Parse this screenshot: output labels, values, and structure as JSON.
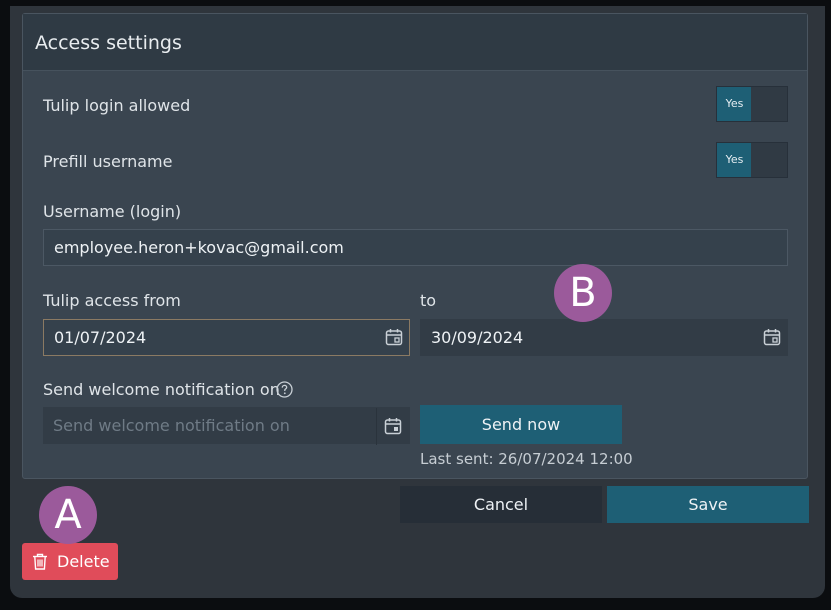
{
  "card": {
    "title": "Access settings"
  },
  "fields": {
    "login_allowed": {
      "label": "Tulip login allowed",
      "toggle_on_label": "Yes"
    },
    "prefill_username": {
      "label": "Prefill username",
      "toggle_on_label": "Yes"
    },
    "username": {
      "label": "Username (login)",
      "value": "employee.heron+kovac@gmail.com"
    },
    "access_from": {
      "label": "Tulip access from",
      "value": "01/07/2024"
    },
    "access_to": {
      "label": "to",
      "value": "30/09/2024"
    },
    "welcome_notification": {
      "label": "Send welcome notification on",
      "placeholder": "Send welcome notification on"
    }
  },
  "buttons": {
    "send_now": "Send now",
    "cancel": "Cancel",
    "save": "Save",
    "delete": "Delete"
  },
  "status": {
    "last_sent": "Last sent: 26/07/2024 12:00"
  },
  "markers": {
    "a": "A",
    "b": "B"
  },
  "icons": {
    "calendar": "calendar-icon",
    "help": "help-circle-icon",
    "trash": "trash-icon"
  },
  "colors": {
    "accent": "#1e5f75",
    "danger": "#e04c5a",
    "marker": "#9b5a9b",
    "card_bg": "#3a4550",
    "header_bg": "#2f3a44"
  }
}
